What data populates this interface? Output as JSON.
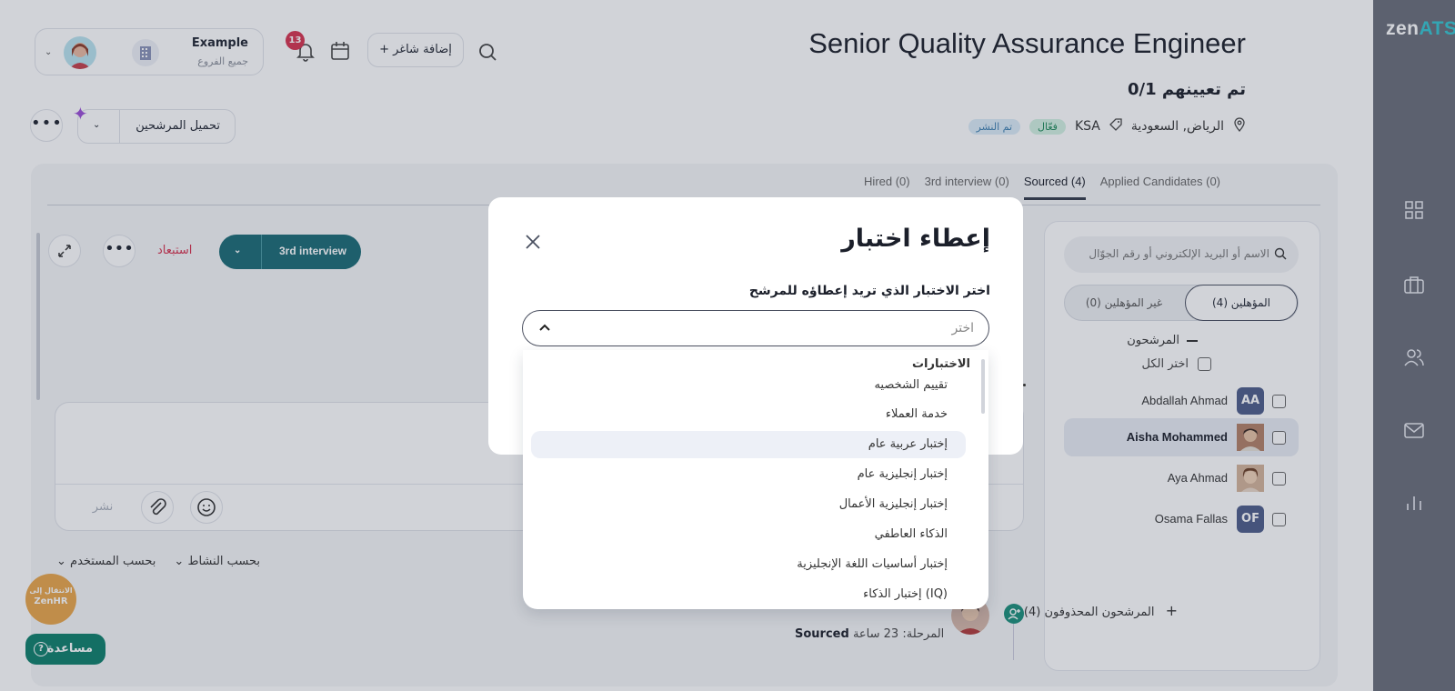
{
  "app": {
    "logo_main": "zen",
    "logo_accent": "ATS",
    "accent_color": "#35c6d1"
  },
  "rail": {
    "icons": [
      "grid-icon",
      "briefcase-icon",
      "users-icon",
      "mail-icon",
      "chart-icon"
    ]
  },
  "header": {
    "tenant_name": "Example",
    "tenant_sub": "جميع الفروع",
    "notification_count": "13",
    "add_job_label": "+ إضافة شاغر"
  },
  "job": {
    "title": "Senior Quality Assurance Engineer",
    "hired_count": "0/1 تم تعيينهم",
    "location": "الرياض, السعودية",
    "tag": "KSA",
    "status_active": "فعّال",
    "status_published": "تم النشر"
  },
  "toolbar": {
    "load_candidates_label": "تحميل المرشحين"
  },
  "tabs": [
    {
      "label": "Applied Candidates (0)",
      "active": false
    },
    {
      "label": "Sourced (4)",
      "active": true
    },
    {
      "label": "3rd interview (0)",
      "active": false
    },
    {
      "label": "Hired (0)",
      "active": false
    }
  ],
  "candidates_panel": {
    "search_placeholder": "الاسم أو البريد الإلكتروني أو رقم الجوّال",
    "qualified_label": "المؤهلين (4)",
    "unqualified_label": "غير المؤهلين (0)",
    "section_title": "المرشحون",
    "select_all_label": "اختر الكل",
    "items": [
      {
        "name": "Abdallah Ahmad",
        "initials": "AA",
        "selected": false
      },
      {
        "name": "Aisha Mohammed",
        "initials": "",
        "selected": true
      },
      {
        "name": "Aya Ahmad",
        "initials": "",
        "selected": false
      },
      {
        "name": "Osama Fallas",
        "initials": "OF",
        "selected": false
      }
    ],
    "deleted_label": "المرشحون المحذوفون (4)"
  },
  "detail": {
    "stage_label": "3rd interview",
    "reject_label": "استبعاد",
    "publish_label": "نشر",
    "filter_user": "بحسب المستخدم",
    "filter_activity": "بحسب النشاط",
    "activity_stage_label": "المرحلة:",
    "activity_stage_value": "Sourced",
    "activity_time": "23 ساعة"
  },
  "widgets": {
    "zenhr_line1": "الانتقال إلى",
    "zenhr_line2": "ZenHR",
    "help_label": "مساعدة"
  },
  "modal": {
    "title": "إعطاء اختبار",
    "field_label": "اختر الاختبار الذي تريد إعطاؤه للمرشح",
    "select_placeholder": "اختر",
    "group_label": "الاختبارات",
    "options": [
      "تقييم الشخصيه",
      "خدمة العملاء",
      "إختبار عربية عام",
      "إختبار إنجليزية عام",
      "إختبار إنجليزية الأعمال",
      "الذكاء العاطفي",
      "إختبار أساسيات اللغة الإنجليزية",
      "إختبار الذكاء (IQ)"
    ],
    "highlighted_index": 2
  }
}
